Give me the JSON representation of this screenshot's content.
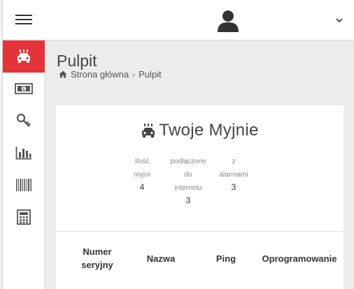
{
  "header": {
    "menu_icon": "hamburger-icon",
    "user_icon": "user-icon",
    "dropdown_icon": "chevron-down-icon"
  },
  "sidebar": {
    "accent_color": "#e4343a",
    "items": [
      {
        "icon": "car-wash-icon",
        "active": true
      },
      {
        "icon": "money-icon",
        "active": false
      },
      {
        "icon": "key-icon",
        "active": false
      },
      {
        "icon": "bar-chart-icon",
        "active": false
      },
      {
        "icon": "barcode-icon",
        "active": false
      },
      {
        "icon": "calculator-icon",
        "active": false
      }
    ]
  },
  "page": {
    "title": "Pulpit",
    "breadcrumb": {
      "home": "Strona główna",
      "separator": "›",
      "current": "Pulpit"
    }
  },
  "card": {
    "title": "Twoje Myjnie",
    "title_icon": "car-wash-icon",
    "stats": [
      {
        "label_lines": [
          "Ilość",
          "myjni"
        ],
        "value": "4"
      },
      {
        "label_lines": [
          "podłączone",
          "do",
          "internetu"
        ],
        "value": "3"
      },
      {
        "label_lines": [
          "z",
          "alarmami"
        ],
        "value": "3"
      }
    ],
    "table_headers": [
      {
        "lines": [
          "Numer",
          "seryjny"
        ]
      },
      {
        "lines": [
          "Nazwa"
        ]
      },
      {
        "lines": [
          "Ping"
        ]
      },
      {
        "lines": [
          "Oprogramowanie"
        ]
      }
    ]
  }
}
